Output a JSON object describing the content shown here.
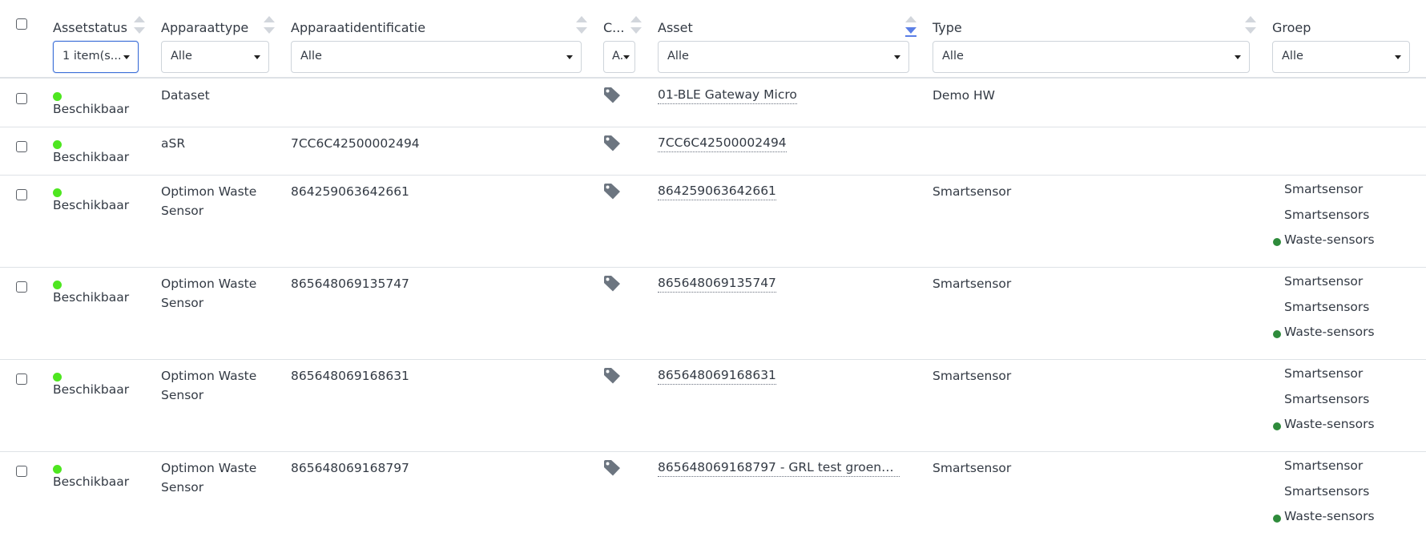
{
  "columns": {
    "assetstatus": {
      "label": "Assetstatus",
      "filter": "1 item(s..."
    },
    "apparaattype": {
      "label": "Apparaattype",
      "filter": "Alle"
    },
    "apparaatidentificatie": {
      "label": "Apparaatidentificatie",
      "filter": "Alle"
    },
    "c": {
      "label": "C...",
      "filter": "A..."
    },
    "asset": {
      "label": "Asset",
      "filter": "Alle"
    },
    "type": {
      "label": "Type",
      "filter": "Alle"
    },
    "groep": {
      "label": "Groep",
      "filter": "Alle"
    }
  },
  "sort": {
    "active_column": "Asset",
    "direction": "descending"
  },
  "colors": {
    "status_available": "#4ee620",
    "group_dot": "#2e8b3b",
    "focus": "#3c6fd8",
    "sort_active": "#5b7fe6"
  },
  "icons": {
    "tag": "tag-icon"
  },
  "rows": [
    {
      "status": "Beschikbaar",
      "type_line1": "Dataset",
      "type_line2": "",
      "ident": "",
      "asset": "01-BLE Gateway Micro",
      "asset_type": "Demo HW",
      "groups": []
    },
    {
      "status": "Beschikbaar",
      "type_line1": "aSR",
      "type_line2": "",
      "ident": "7CC6C42500002494",
      "asset": "7CC6C42500002494",
      "asset_type": "",
      "groups": []
    },
    {
      "status": "Beschikbaar",
      "type_line1": "Optimon Waste",
      "type_line2": "Sensor",
      "ident": "864259063642661",
      "asset": "864259063642661",
      "asset_type": "Smartsensor",
      "groups": [
        "Smartsensor",
        "Smartsensors",
        "Waste-sensors"
      ]
    },
    {
      "status": "Beschikbaar",
      "type_line1": "Optimon Waste",
      "type_line2": "Sensor",
      "ident": "865648069135747",
      "asset": "865648069135747",
      "asset_type": "Smartsensor",
      "groups": [
        "Smartsensor",
        "Smartsensors",
        "Waste-sensors"
      ]
    },
    {
      "status": "Beschikbaar",
      "type_line1": "Optimon Waste",
      "type_line2": "Sensor",
      "ident": "865648069168631",
      "asset": "865648069168631",
      "asset_type": "Smartsensor",
      "groups": [
        "Smartsensor",
        "Smartsensors",
        "Waste-sensors"
      ]
    },
    {
      "status": "Beschikbaar",
      "type_line1": "Optimon Waste",
      "type_line2": "Sensor",
      "ident": "865648069168797",
      "asset": "865648069168797 - GRL test groene ...",
      "asset_type": "Smartsensor",
      "groups": [
        "Smartsensor",
        "Smartsensors",
        "Waste-sensors"
      ]
    }
  ]
}
